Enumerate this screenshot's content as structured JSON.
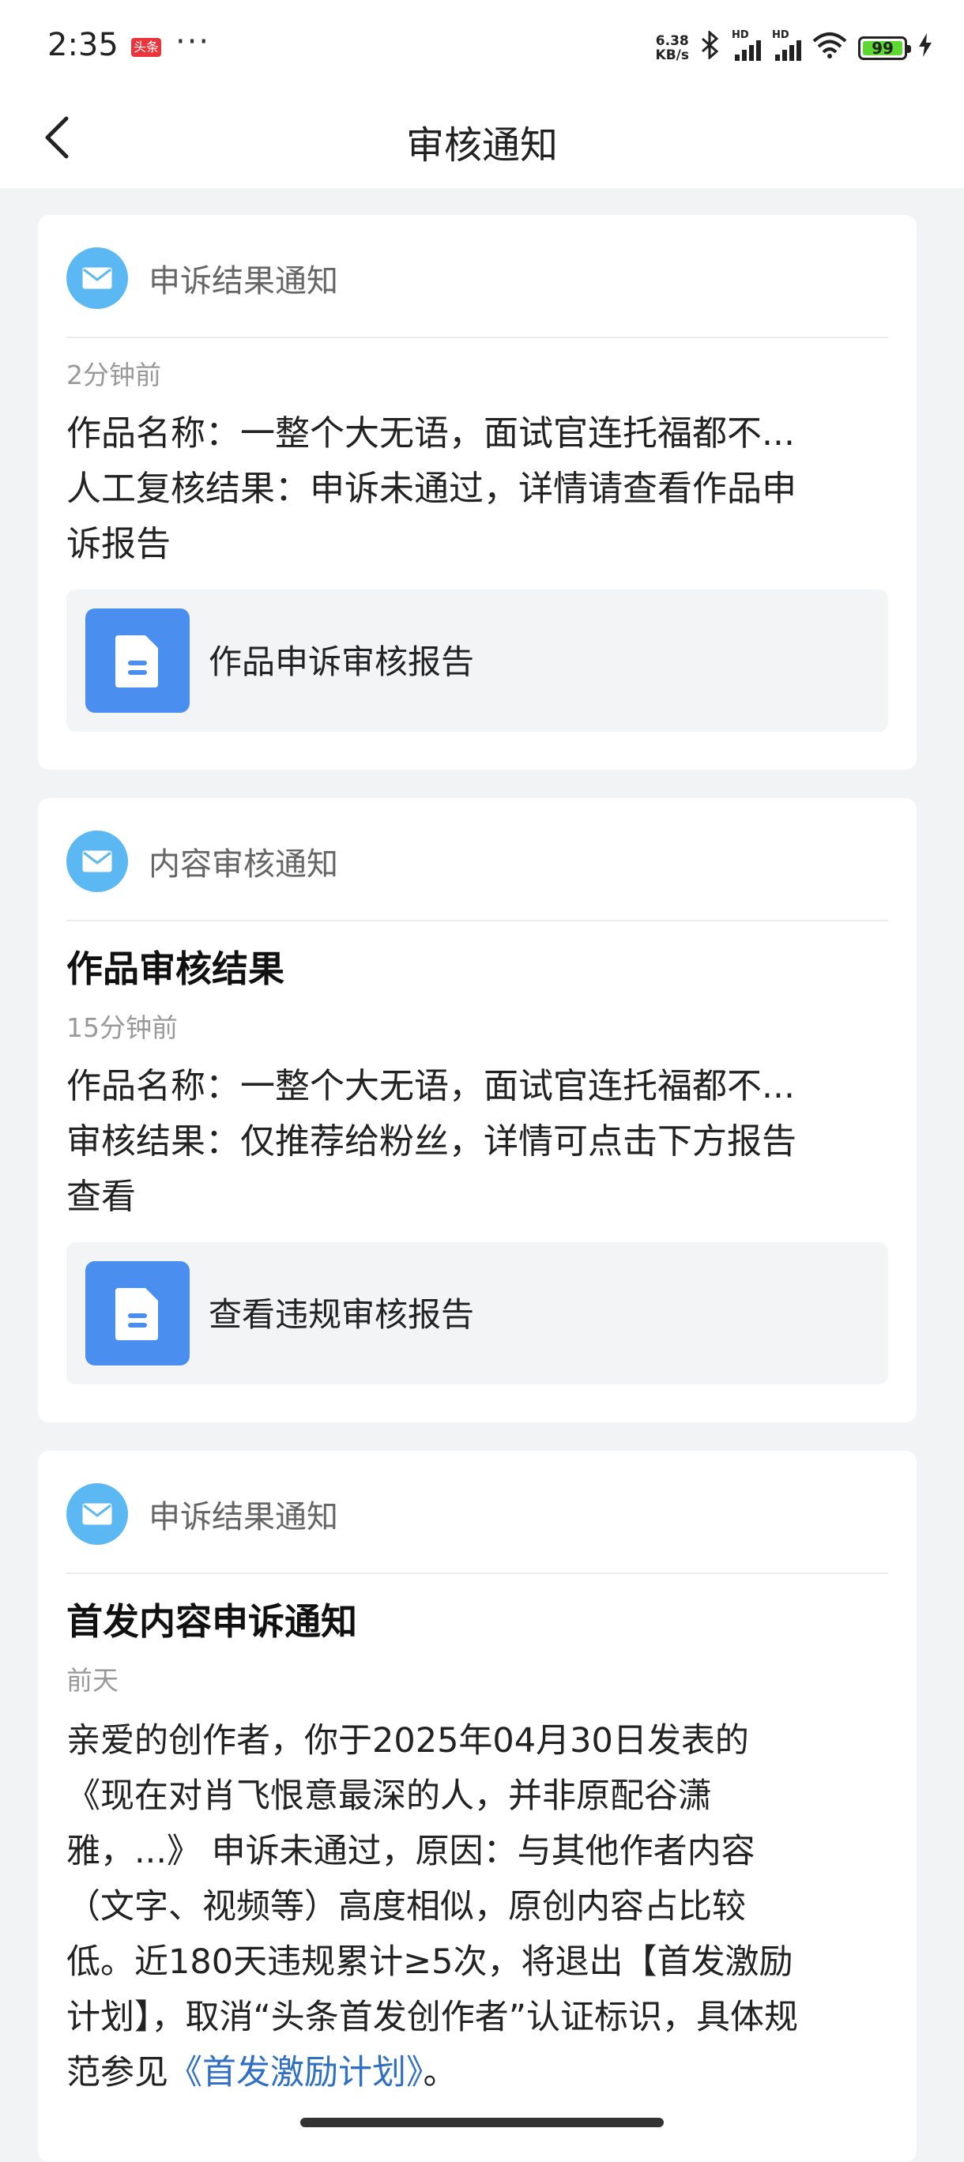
{
  "status_bar": {
    "time": "2:35",
    "app_badge": "头条",
    "more": "···",
    "net_speed_value": "6.38",
    "net_speed_unit": "KB/s",
    "signal_label": "HD",
    "battery_level": "99",
    "icons": [
      "bluetooth-icon",
      "signal-icon",
      "signal-icon",
      "wifi-icon",
      "battery-icon",
      "charging-icon"
    ]
  },
  "nav": {
    "back_icon": "chevron-left-icon",
    "title": "审核通知"
  },
  "cards": [
    {
      "type": "申诉结果通知",
      "title": "",
      "time": "2分钟前",
      "body_lines": [
        "作品名称：一整个大无语，面试官连托福都不...",
        "人工复核结果：申诉未通过，详情请查看作品申",
        "诉报告"
      ],
      "report_label": "作品申诉审核报告"
    },
    {
      "type": "内容审核通知",
      "title": "作品审核结果",
      "time": "15分钟前",
      "body_lines": [
        "作品名称：一整个大无语，面试官连托福都不...",
        "审核结果：仅推荐给粉丝，详情可点击下方报告",
        "查看"
      ],
      "report_label": "查看违规审核报告"
    },
    {
      "type": "申诉结果通知",
      "title": "首发内容申诉通知",
      "time": "前天",
      "body_lines": [
        "亲爱的创作者，你于2025年04月30日发表的",
        "《现在对肖飞恨意最深的人，并非原配谷潇",
        "雅，...》 申诉未通过，原因：与其他作者内容",
        "（文字、视频等）高度相似，原创内容占比较",
        "低。近180天违规累计≥5次，将退出【首发激励",
        "计划】，取消“头条首发创作者”认证标识，具体规"
      ],
      "last_line_prefix": "范参见",
      "last_line_link": "《首发激励计划》",
      "last_line_suffix": "。"
    }
  ]
}
